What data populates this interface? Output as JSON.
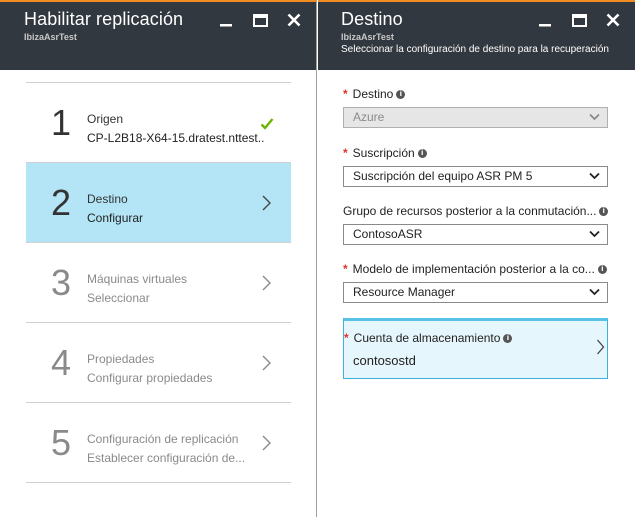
{
  "left_blade": {
    "title": "Habilitar replicación",
    "subtitle": "IbizaAsrTest",
    "steps": [
      {
        "number": "1",
        "title": "Origen",
        "subtitle": "CP-L2B18-X64-15.dratest.nttest...",
        "state": "completed"
      },
      {
        "number": "2",
        "title": "Destino",
        "subtitle": "Configurar",
        "state": "active"
      },
      {
        "number": "3",
        "title": "Máquinas virtuales",
        "subtitle": "Seleccionar",
        "state": "disabled"
      },
      {
        "number": "4",
        "title": "Propiedades",
        "subtitle": "Configurar propiedades",
        "state": "disabled"
      },
      {
        "number": "5",
        "title": "Configuración de replicación",
        "subtitle": "Establecer configuración de...",
        "state": "disabled"
      }
    ]
  },
  "right_blade": {
    "title": "Destino",
    "subtitle": "IbizaAsrTest",
    "description": "Seleccionar la configuración de destino para la recuperación",
    "fields": [
      {
        "label": "Destino",
        "required": true,
        "value": "Azure",
        "disabled": true
      },
      {
        "label": "Suscripción",
        "required": true,
        "value": "Suscripción del equipo ASR PM 5",
        "disabled": false
      },
      {
        "label": "Grupo de recursos posterior a la conmutación...",
        "required": false,
        "value": "ContosoASR",
        "disabled": false
      },
      {
        "label": "Modelo de implementación posterior a la co...",
        "required": true,
        "value": "Resource Manager",
        "disabled": false
      }
    ],
    "storage": {
      "label": "Cuenta de almacenamiento",
      "required": true,
      "value": "contosostd"
    }
  },
  "icons": {
    "minimize": "minimize-icon",
    "maximize": "maximize-icon",
    "close": "close-icon",
    "info": "info-icon",
    "check": "checkmark-icon",
    "chevron_right": "chevron-right-icon",
    "chevron_down": "chevron-down-icon"
  },
  "colors": {
    "header_bg": "#32383f",
    "header_accent": "#f08c22",
    "active_step_bg": "#b3e5f7",
    "check_green": "#6bb700",
    "required_red": "#e0342a",
    "storage_bg": "#e6f6fd",
    "storage_border": "#3db0dc"
  }
}
